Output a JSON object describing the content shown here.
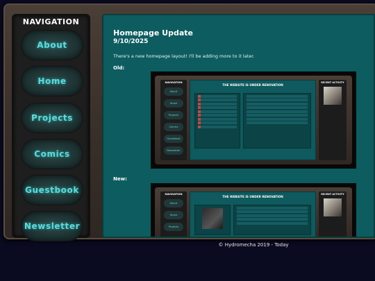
{
  "nav": {
    "title": "NAVIGATION",
    "items": [
      {
        "label": "About"
      },
      {
        "label": "Home"
      },
      {
        "label": "Projects"
      },
      {
        "label": "Comics"
      },
      {
        "label": "Guestbook"
      },
      {
        "label": "Newsletter"
      }
    ]
  },
  "post": {
    "title": "Homepage Update",
    "date": "9/10/2025",
    "body": "There's a new homepage layout! I'll be adding more to it later.",
    "old_label": "Old:",
    "new_label": "New:"
  },
  "mini": {
    "nav_title": "NAVIGATION",
    "items": [
      "About",
      "Home",
      "Projects",
      "Comics",
      "Guestbook",
      "Newsletter"
    ],
    "new_items": [
      "About",
      "Home",
      "Projects"
    ],
    "heading": "THE WEBSITE IS UNDER RENOVATION",
    "side_title": "RECENT ACTIVITY"
  },
  "footer": {
    "text": "© Hydromecha 2019 - Today"
  },
  "colors": {
    "accent": "#5fd9d9",
    "content_bg": "#0d5c60",
    "page_bg": "#0a0a20"
  }
}
